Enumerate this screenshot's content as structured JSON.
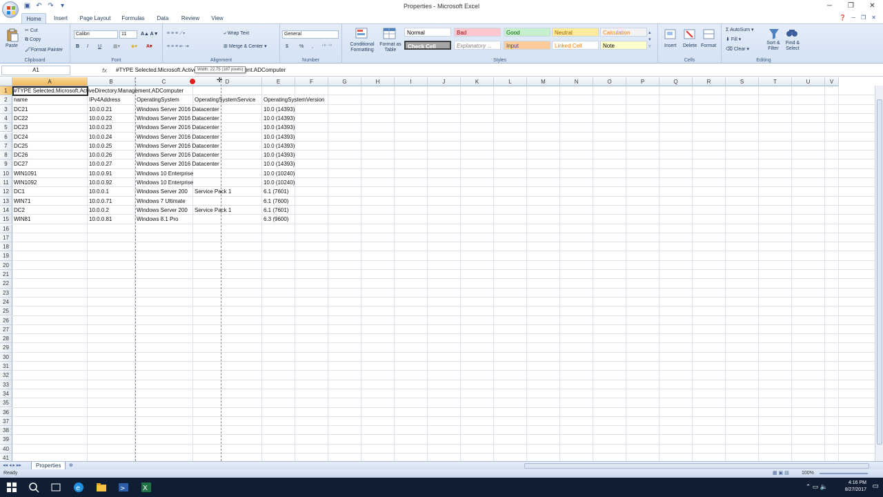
{
  "window": {
    "title": "Properties - Microsoft Excel",
    "qat": [
      "save",
      "undo",
      "redo",
      "customize"
    ],
    "controls": [
      "minimize",
      "restore",
      "close"
    ]
  },
  "ribbon_tabs": [
    "Home",
    "Insert",
    "Page Layout",
    "Formulas",
    "Data",
    "Review",
    "View"
  ],
  "ribbon": {
    "clipboard": {
      "label": "Clipboard",
      "paste": "Paste",
      "cut": "Cut",
      "copy": "Copy",
      "format_painter": "Format Painter"
    },
    "font": {
      "label": "Font",
      "name": "Calibri",
      "size": "11",
      "bold": "B",
      "italic": "I",
      "underline": "U"
    },
    "alignment": {
      "label": "Alignment",
      "wrap": "Wrap Text",
      "merge": "Merge & Center"
    },
    "number": {
      "label": "Number",
      "format": "General",
      "currency": "$",
      "percent": "%",
      "comma": ","
    },
    "styles": {
      "label": "Styles",
      "conditional": "Conditional Formatting",
      "format_table": "Format as Table",
      "boxes": [
        {
          "name": "Normal",
          "fg": "#000000",
          "bg": "#ffffff"
        },
        {
          "name": "Bad",
          "fg": "#9c0006",
          "bg": "#ffc7ce"
        },
        {
          "name": "Good",
          "fg": "#006100",
          "bg": "#c6efce"
        },
        {
          "name": "Neutral",
          "fg": "#9c6500",
          "bg": "#ffeb9c"
        },
        {
          "name": "Calculation",
          "fg": "#fa7d00",
          "bg": "#f2f2f2"
        },
        {
          "name": "Check Cell",
          "fg": "#ffffff",
          "bg": "#a5a5a5"
        },
        {
          "name": "Explanatory ...",
          "fg": "#7f7f7f",
          "bg": "#ffffff"
        },
        {
          "name": "Input",
          "fg": "#3f3f76",
          "bg": "#ffcc99"
        },
        {
          "name": "Linked Cell",
          "fg": "#fa7d00",
          "bg": "#ffffff"
        },
        {
          "name": "Note",
          "fg": "#000000",
          "bg": "#ffffcc"
        }
      ]
    },
    "cells": {
      "label": "Cells",
      "insert": "Insert",
      "delete": "Delete",
      "format": "Format"
    },
    "editing": {
      "label": "Editing",
      "autosum": "AutoSum",
      "fill": "Fill",
      "clear": "Clear",
      "sort": "Sort & Filter",
      "find": "Find & Select"
    }
  },
  "formula_bar": {
    "name_box": "A1",
    "fx": "fx",
    "value": "#TYPE Selected.Microsoft.ActiveDirectory.Management.ADComputer",
    "tooltip": "Width: 22.75 (187 pixels)"
  },
  "columns": [
    "A",
    "B",
    "C",
    "D",
    "E",
    "F",
    "G",
    "H",
    "I",
    "J",
    "K",
    "L",
    "M",
    "N",
    "O",
    "P",
    "Q",
    "R",
    "S",
    "T",
    "U",
    "V"
  ],
  "rows": [
    [
      "#TYPE Selected.Microsoft.ActiveDirectory.Management.ADComputer",
      "",
      "",
      "",
      ""
    ],
    [
      "name",
      "IPv4Address",
      "OperatingSystem",
      "OperatingSystemService",
      "OperatingSystemVersion"
    ],
    [
      "DC21",
      "10.0.0.21",
      "Windows Server 2016 Datacenter",
      "",
      "10.0 (14393)"
    ],
    [
      "DC22",
      "10.0.0.22",
      "Windows Server 2016 Datacenter",
      "",
      "10.0 (14393)"
    ],
    [
      "DC23",
      "10.0.0.23",
      "Windows Server 2016 Datacenter",
      "",
      "10.0 (14393)"
    ],
    [
      "DC24",
      "10.0.0.24",
      "Windows Server 2016 Datacenter",
      "",
      "10.0 (14393)"
    ],
    [
      "DC25",
      "10.0.0.25",
      "Windows Server 2016 Datacenter",
      "",
      "10.0 (14393)"
    ],
    [
      "DC26",
      "10.0.0.26",
      "Windows Server 2016 Datacenter",
      "",
      "10.0 (14393)"
    ],
    [
      "DC27",
      "10.0.0.27",
      "Windows Server 2016 Datacenter",
      "",
      "10.0 (14393)"
    ],
    [
      "WIN1091",
      "10.0.0.91",
      "Windows 10 Enterprise",
      "",
      "10.0 (10240)"
    ],
    [
      "WIN1092",
      "10.0.0.92",
      "Windows 10 Enterprise",
      "",
      "10.0 (10240)"
    ],
    [
      "DC1",
      "10.0.0.1",
      "Windows Server 200",
      "Service Pack 1",
      "6.1 (7601)"
    ],
    [
      "WIN71",
      "10.0.0.71",
      "Windows 7 Ultimate",
      "",
      "6.1 (7600)"
    ],
    [
      "DC2",
      "10.0.0.2",
      "Windows Server 200",
      "Service Pack 1",
      "6.1 (7601)"
    ],
    [
      "WIN81",
      "10.0.0.81",
      "Windows 8.1 Pro",
      "",
      "6.3 (9600)"
    ]
  ],
  "row_count": 41,
  "sheet_tab": "Properties",
  "status": {
    "left": "Ready",
    "zoom": "100%"
  },
  "clock": {
    "time": "4:16 PM",
    "date": "8/27/2017"
  }
}
